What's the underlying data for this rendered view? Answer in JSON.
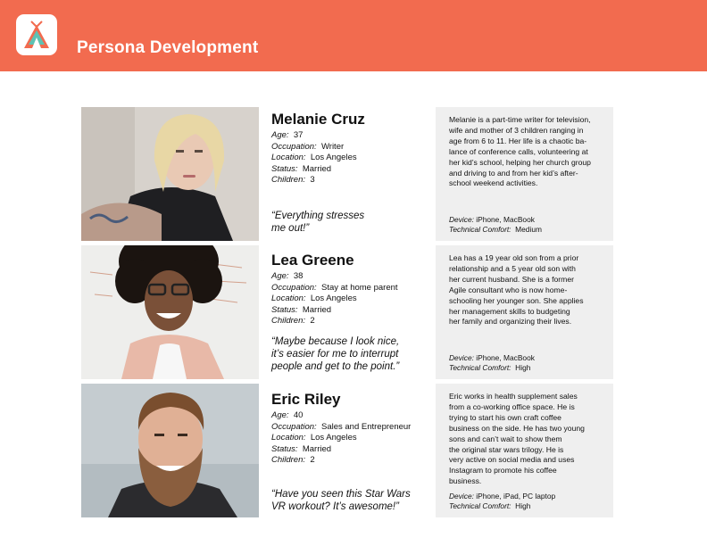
{
  "header": {
    "title": "Persona Development",
    "logo_icon": "tent-icon",
    "color": "#f26b4f"
  },
  "labels": {
    "age": "Age:",
    "occupation": "Occupation:",
    "location": "Location:",
    "status": "Status:",
    "children": "Children:",
    "device": "Device:",
    "comfort": "Technical Comfort:"
  },
  "personas": [
    {
      "name": "Melanie Cruz",
      "age": "37",
      "occupation": "Writer",
      "location": "Los Angeles",
      "status": "Married",
      "children": "3",
      "quote_lines": [
        "“Everything stresses",
        "me out!”"
      ],
      "bio_lines": [
        "Melanie is a part-time writer for television,",
        "wife and mother of 3 children ranging in",
        "age from 6 to 11. Her life is a chaotic ba-",
        "lance of conference calls, volunteering at",
        "her kid’s school, helping her church group",
        "and driving to and from her kid’s after-",
        "school weekend activities."
      ],
      "device": "iPhone, MacBook",
      "comfort": "Medium"
    },
    {
      "name": "Lea Greene",
      "age": "38",
      "occupation": "Stay at home parent",
      "location": "Los Angeles",
      "status": "Married",
      "children": "2",
      "quote_lines": [
        "“Maybe because I look nice,",
        "it’s easier for me to interrupt",
        "people and get to the point.”"
      ],
      "bio_lines": [
        "Lea has a 19 year old son from a prior",
        "relationship and a 5 year old son with",
        "her current husband. She is a former",
        "Agile consultant who is now home-",
        "schooling her younger son. She applies",
        "her management skills to budgeting",
        "her family and organizing their lives."
      ],
      "device": "iPhone, MacBook",
      "comfort": "High"
    },
    {
      "name": "Eric Riley",
      "age": "40",
      "occupation": "Sales and Entrepreneur",
      "location": "Los Angeles",
      "status": "Married",
      "children": "2",
      "quote_lines": [
        "“Have you seen this Star Wars",
        "VR workout? It’s awesome!”"
      ],
      "bio_lines": [
        "Eric works in health supplement sales",
        "from a co-working office space. He is",
        "trying to start his own craft coffee",
        "business on the side. He has two young",
        "sons and can’t wait to show them",
        "the original star wars trilogy. He is",
        "very active on social media and uses",
        "Instagram to promote his coffee",
        "business."
      ],
      "device": "iPhone, iPad, PC laptop",
      "comfort": "High"
    }
  ]
}
